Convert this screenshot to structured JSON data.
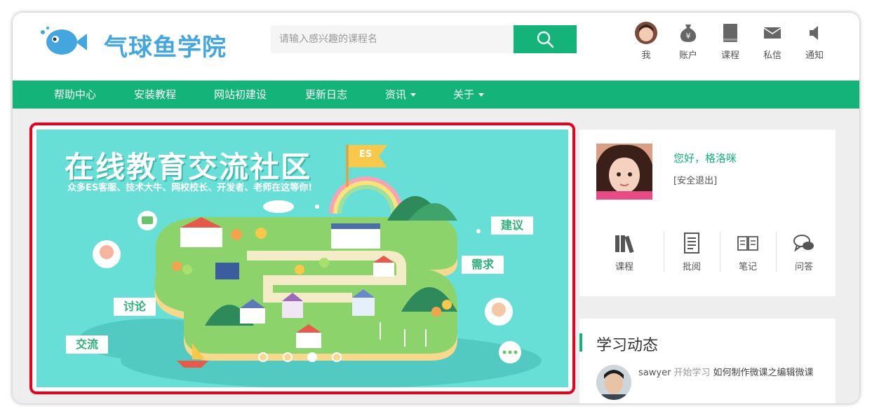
{
  "header": {
    "logo_text": "气球鱼学院",
    "search_placeholder": "请输入感兴趣的课程名",
    "icons": [
      {
        "label": "我",
        "icon": "user-avatar-icon"
      },
      {
        "label": "账户",
        "icon": "money-bag-icon"
      },
      {
        "label": "课程",
        "icon": "book-icon"
      },
      {
        "label": "私信",
        "icon": "mail-icon"
      },
      {
        "label": "通知",
        "icon": "speaker-icon"
      }
    ]
  },
  "nav": {
    "items": [
      {
        "label": "帮助中心"
      },
      {
        "label": "安装教程"
      },
      {
        "label": "网站初建设"
      },
      {
        "label": "更新日志"
      },
      {
        "label": "资讯"
      },
      {
        "label": "关于"
      }
    ]
  },
  "banner": {
    "title": "在线教育交流社区",
    "subtitle": "众多ES客服、技术大牛、网校校长、开发者、老师在这等你!",
    "flag_text": "ES",
    "tags": [
      "建议",
      "需求",
      "讨论",
      "交流"
    ],
    "slides": 4,
    "active_slide": 3
  },
  "user_card": {
    "greeting": "您好，格洛咪",
    "logout": "[安全退出]",
    "quick_links": [
      {
        "label": "课程",
        "icon": "books-icon"
      },
      {
        "label": "批阅",
        "icon": "document-icon"
      },
      {
        "label": "笔记",
        "icon": "open-book-icon"
      },
      {
        "label": "问答",
        "icon": "chat-bubbles-icon"
      }
    ]
  },
  "feed": {
    "title": "学习动态",
    "items": [
      {
        "user": "sawyer",
        "action": "开始学习",
        "content": "如何制作微课之编辑微课"
      }
    ]
  },
  "colors": {
    "brand_green": "#13b37a",
    "logo_blue": "#44a6de",
    "banner_bg": "#67dfd7",
    "highlight_red": "#e8001c"
  }
}
